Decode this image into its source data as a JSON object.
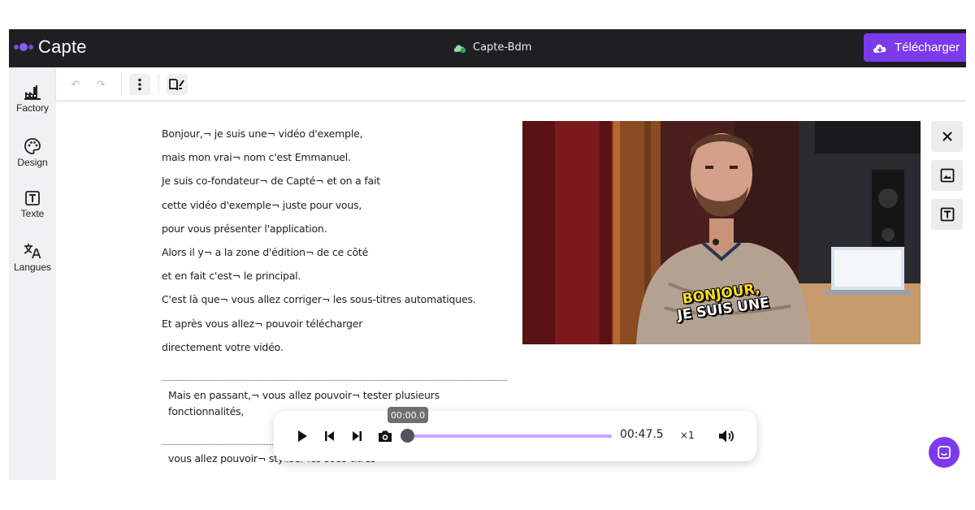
{
  "app": {
    "name": "Capte",
    "project_name": "Capte-Bdm",
    "download_label": "Télécharger"
  },
  "sidebar": {
    "items": [
      {
        "label": "Factory",
        "icon": "factory-icon"
      },
      {
        "label": "Design",
        "icon": "palette-icon"
      },
      {
        "label": "Texte",
        "icon": "text-icon"
      },
      {
        "label": "Langues",
        "icon": "translate-icon"
      }
    ]
  },
  "transcript": {
    "lines": [
      "Bonjour,¬ je suis une¬ vidéo d'exemple,",
      "mais mon vrai¬ nom c'est Emmanuel.",
      "Je suis co-fondateur¬ de Capté¬ et on a fait",
      "cette vidéo d'exemple¬ juste pour vous,",
      "pour vous présenter l'application.",
      "Alors il y¬ a la zone d'édition¬ de ce côté",
      "et en fait c'est¬ le principal.",
      "C'est là que¬ vous allez corriger¬ les sous-titres automatiques.",
      "Et après vous allez¬ pouvoir télécharger",
      "directement votre vidéo."
    ],
    "paragraph2": "Mais en passant,¬ vous allez pouvoir¬ tester plusieurs fonctionnalités,",
    "paragraph3": "vous allez pouvoir¬ styliser les sous-titres"
  },
  "video": {
    "subtitle_line1": "BONJOUR,",
    "subtitle_line2": "JE SUIS UNE"
  },
  "player": {
    "tooltip_time": "00:00.0",
    "duration": "00:47.5",
    "speed": "×1",
    "progress": 0.0
  },
  "colors": {
    "accent": "#7c3aed",
    "topbar": "#1f1f23",
    "sidebar": "#f1f1f3"
  }
}
